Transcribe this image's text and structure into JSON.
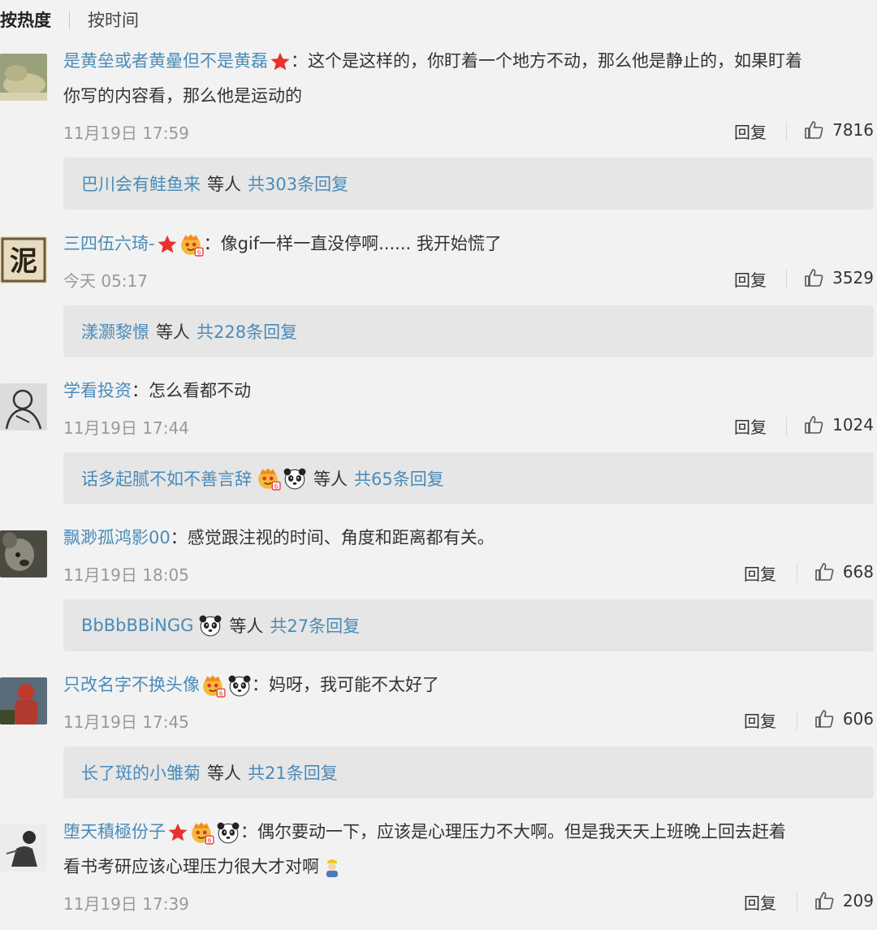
{
  "sort": {
    "hot": "按热度",
    "time": "按时间"
  },
  "colors": {
    "username": "#4a8bb8",
    "star": "#e8322d",
    "crown": "#f4a623",
    "background": "#f2f2f2",
    "subbox": "#e6e6e6"
  },
  "reply_label": "回复",
  "comments": [
    {
      "username": "是黄垒或者黄曐但不是黄磊",
      "badges": [
        "star-icon"
      ],
      "text_line1": "：这个是这样的，你盯着一个地方不动，那么他是静止的，如果盯着",
      "text_line2": "你写的内容看，那么他是运动的",
      "time": "11月19日 17:59",
      "likes": "7816",
      "replies_users": "巴川会有鲑鱼来",
      "replies_etc": "等人",
      "replies_count": "共303条回复"
    },
    {
      "username": "三四伍六琦-",
      "badges": [
        "star-icon",
        "vip-face-icon"
      ],
      "text_line1": "：像gif一样一直没停啊...... 我开始慌了",
      "time": "今天 05:17",
      "likes": "3529",
      "replies_users": "漾灏黎憬",
      "replies_etc": "等人",
      "replies_count": "共228条回复"
    },
    {
      "username": "学看投资",
      "badges": [],
      "text_line1": "：怎么看都不动",
      "time": "11月19日 17:44",
      "likes": "1024",
      "replies_users": "话多起腻不如不善言辞",
      "replies_etc": "等人",
      "replies_count": "共65条回复"
    },
    {
      "username": "飘渺孤鸿影00",
      "badges": [],
      "text_line1": "：感觉跟注视的时间、角度和距离都有关。",
      "time": "11月19日 18:05",
      "likes": "668",
      "replies_users": "BbBbBBiNGG",
      "replies_etc": "等人",
      "replies_count": "共27条回复"
    },
    {
      "username": "只改名字不换头像",
      "badges": [
        "vip-face-icon",
        "panda-icon"
      ],
      "text_line1": "：妈呀，我可能不太好了",
      "time": "11月19日 17:45",
      "likes": "606",
      "replies_users": "长了斑的小雏菊",
      "replies_etc": "等人",
      "replies_count": "共21条回复"
    },
    {
      "username": "堕天積極份子",
      "badges": [
        "star-icon",
        "vip-face-icon",
        "panda-icon"
      ],
      "text_line1": "：偶尔要动一下，应该是心理压力不大啊。但是我天天上班晚上回去赶着",
      "text_line2": "看书考研应该心理压力很大才对啊",
      "time": "11月19日 17:39",
      "likes": "209"
    }
  ]
}
